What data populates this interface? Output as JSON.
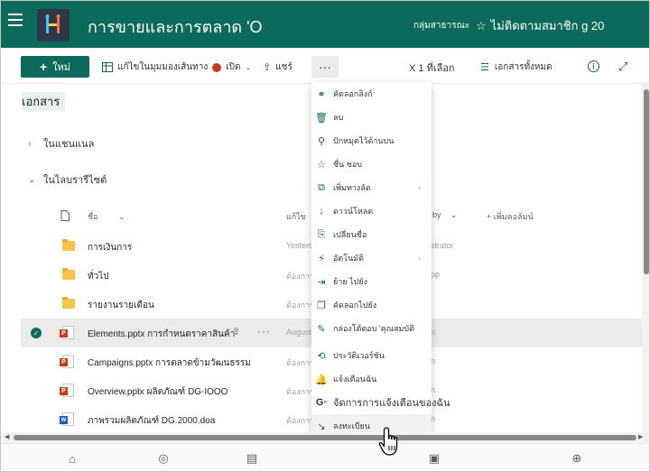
{
  "header": {
    "site_title": "การขายและการตลาด 'O",
    "group_label": "กลุ่มสาธารณะ",
    "follow_label": "ไม่ติดตามสมาชิก g 20"
  },
  "commandbar": {
    "new_label": "ใหม่",
    "open_label": "แก้ไขในมุมมองเส้นทาง",
    "open2_label": "เปิด",
    "share_label": "แชร์",
    "more_label": "···",
    "selected_count": "X 1 ที่เลือก",
    "all_docs_label": "เอกสารทั้งหมด"
  },
  "library": {
    "title": "เอกสาร",
    "section_collapsed": "ในแชนแนล",
    "section_expanded": "ในไลบรารีไซต์",
    "columns": {
      "name": "ชื่อ",
      "modified": "แก้ไข",
      "modified_by": "by",
      "add_column": "+ เพิ่มคอลัมน์"
    },
    "rows": [
      {
        "type": "folder",
        "name": "การเงินการ",
        "modified": "Yesterd",
        "modified_by": "strator"
      },
      {
        "type": "folder",
        "name": "ทั่วไป",
        "modified": "ต้องการ",
        "modified_by": "pp"
      },
      {
        "type": "folder",
        "name": "รายงานรายเดือน",
        "modified": "ต้องการ",
        "modified_by": ""
      },
      {
        "type": "ppt",
        "name": "Elements.pptx การกำหนดราคาสินค้า",
        "modified": "August",
        "modified_by": "n",
        "selected": true
      },
      {
        "type": "ppt",
        "name": "Campaigns.pptx การตลาดข้ามวัฒนธรรม",
        "modified": "ต้องการ",
        "modified_by": "n"
      },
      {
        "type": "ppt",
        "name": "Overview.pptx ผลิตภัณฑ์ DG-IOOO",
        "modified": "ต้องการ",
        "modified_by": "n"
      },
      {
        "type": "doc",
        "name": "ภาพรวมผลิตภัณฑ์ DG.2000.doa",
        "modified": "ต้องการ",
        "modified_by": "n"
      }
    ]
  },
  "context_menu": {
    "items": [
      {
        "icon": "link-icon",
        "label": "คัดลอกลิงก์"
      },
      {
        "icon": "trash-icon",
        "label": "ลบ"
      },
      {
        "icon": "pin-icon",
        "label": "ปักหมุดไว้ด้านบน"
      },
      {
        "icon": "star-icon",
        "label": "ชื่น ชอบ"
      },
      {
        "icon": "open-icon",
        "label": "เพิ่มทางลัด",
        "submenu": true
      },
      {
        "icon": "download-icon",
        "label": "ดาวน์โหลด"
      },
      {
        "icon": "rename-icon",
        "label": "เปลี่ยนชื่อ"
      },
      {
        "icon": "automate-icon",
        "label": "อัตโนมัติ",
        "submenu": true
      },
      {
        "icon": "move-icon",
        "label": "ย้าย ไปยัง"
      },
      {
        "icon": "copy-icon",
        "label": "คัดลอกไปยัง"
      },
      {
        "icon": "properties-icon",
        "label": "กล่องโต้ตอบ 'คุณสมบัติ"
      },
      {
        "icon": "history-icon",
        "label": "ประวัติเวอร์ชัน"
      },
      {
        "icon": "bell-icon",
        "label": "แจ้งเตือนฉัน"
      },
      {
        "icon": "manage-alerts-icon",
        "label": "จัดการการแจ้งเตือนของฉัน",
        "prefix": "G·"
      },
      {
        "icon": "checkin-icon",
        "label": "ลงทะเบียน"
      }
    ]
  },
  "bottomnav": {
    "items": [
      "home-icon",
      "globe-icon",
      "news-icon",
      "files-icon",
      "add-icon"
    ]
  },
  "colors": {
    "brand": "#0b6a5a",
    "header_bg": "#0b6a5a"
  }
}
